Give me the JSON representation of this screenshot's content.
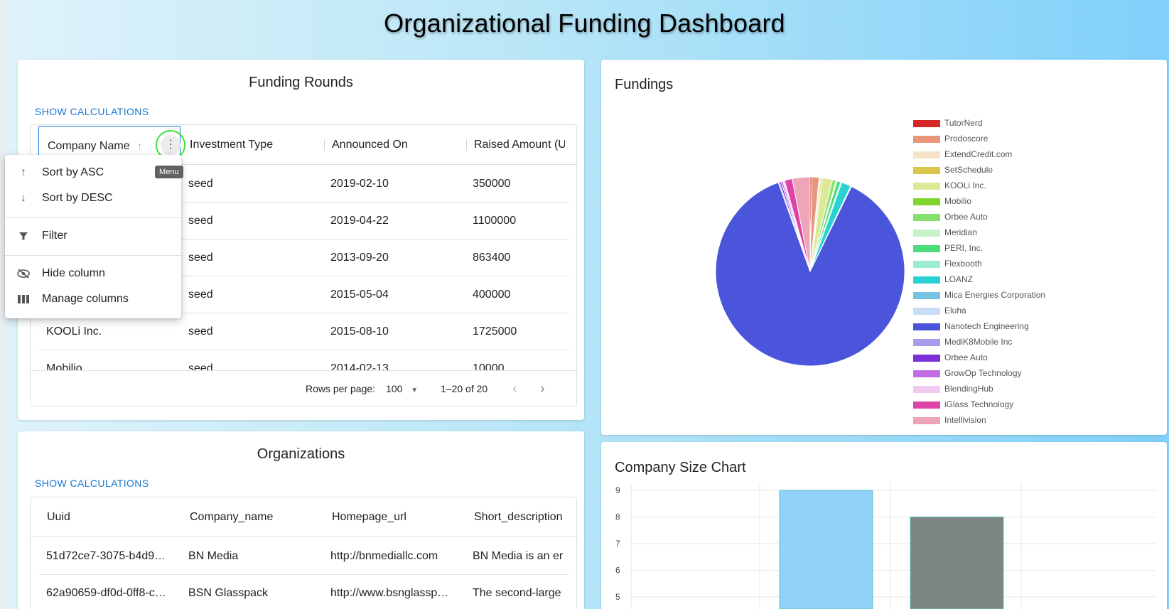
{
  "page": {
    "title": "Organizational Funding Dashboard"
  },
  "funding_rounds": {
    "title": "Funding Rounds",
    "show_calc": "SHOW CALCULATIONS",
    "columns": [
      "Company Name",
      "Investment Type",
      "Announced On",
      "Raised Amount (U"
    ],
    "rows": [
      [
        "",
        "seed",
        "2019-02-10",
        "350000"
      ],
      [
        "",
        "seed",
        "2019-04-22",
        "1100000"
      ],
      [
        "",
        "seed",
        "2013-09-20",
        "863400"
      ],
      [
        "",
        "seed",
        "2015-05-04",
        "400000"
      ],
      [
        "KOOLi Inc.",
        "seed",
        "2015-08-10",
        "1725000"
      ],
      [
        "Mobilio",
        "seed",
        "2014-02-13",
        "10000"
      ]
    ],
    "footer": {
      "rows_per_page_label": "Rows per page:",
      "rows_per_page_value": "100",
      "range": "1–20 of 20"
    },
    "column_menu": {
      "tooltip": "Menu",
      "items": [
        "Sort by ASC",
        "Sort by DESC",
        "Filter",
        "Hide column",
        "Manage columns"
      ]
    }
  },
  "organizations": {
    "title": "Organizations",
    "show_calc": "SHOW CALCULATIONS",
    "columns": [
      "Uuid",
      "Company_name",
      "Homepage_url",
      "Short_description"
    ],
    "rows": [
      [
        "51d72ce7-3075-b4d9…",
        "BN Media",
        "http://bnmediallc.com",
        "BN Media is an er"
      ],
      [
        "62a90659-df0d-0ff8-c…",
        "BSN Glasspack",
        "http://www.bsnglassp…",
        "The second-large"
      ]
    ]
  },
  "fundings": {
    "title": "Fundings",
    "chart_data": {
      "type": "pie",
      "labels": [
        "TutorNerd",
        "Prodoscore",
        "ExtendCredit.com",
        "SetSchedule",
        "KOOLi Inc.",
        "Mobilio",
        "Orbee Auto",
        "Meridian",
        "PERI, Inc.",
        "Flexbooth",
        "LOANZ",
        "Mica Energies Corporation",
        "Eluha",
        "Nanotech Engineering",
        "MediK8Mobile Inc",
        "Orbee Auto",
        "GrowOp Technology",
        "BlendingHub",
        "iGlass Technology",
        "Intellivision"
      ],
      "values": [
        0.3,
        1.2,
        0.3,
        0.25,
        1.7,
        0.01,
        0.6,
        0.2,
        0.6,
        0.2,
        1.6,
        0.05,
        0.1,
        86.0,
        0.2,
        0.3,
        0.3,
        0.3,
        1.3,
        3.0
      ],
      "colors": [
        "#d62728",
        "#e8957a",
        "#f6e3c7",
        "#d9c64a",
        "#dcea98",
        "#7ed62f",
        "#86e06e",
        "#c7f2c9",
        "#4ddb7c",
        "#9cecd4",
        "#28d2d2",
        "#74c3e3",
        "#c9def6",
        "#4a55db",
        "#a79bec",
        "#7c2fd6",
        "#c26de3",
        "#f1caf1",
        "#dc44a8",
        "#eea5b8"
      ]
    }
  },
  "company_size": {
    "title": "Company Size Chart",
    "chart_data": {
      "type": "bar",
      "values": [
        9,
        8
      ],
      "colors": [
        "#90d2f9",
        "#7b8582"
      ],
      "yticks": [
        5,
        6,
        7,
        8,
        9
      ]
    }
  }
}
